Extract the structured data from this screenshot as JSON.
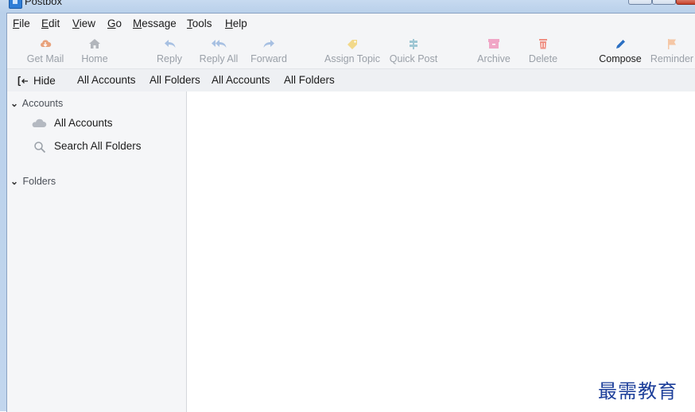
{
  "window": {
    "title": "Postbox"
  },
  "menubar": {
    "items": [
      {
        "key": "F",
        "rest": "ile"
      },
      {
        "key": "E",
        "rest": "dit"
      },
      {
        "key": "V",
        "rest": "iew"
      },
      {
        "key": "G",
        "rest": "o"
      },
      {
        "key": "M",
        "rest": "essage"
      },
      {
        "key": "T",
        "rest": "ools"
      },
      {
        "key": "H",
        "rest": "elp"
      }
    ]
  },
  "toolbar": {
    "get_mail": "Get Mail",
    "home": "Home",
    "reply": "Reply",
    "reply_all": "Reply All",
    "forward": "Forward",
    "assign_topic": "Assign Topic",
    "quick_post": "Quick Post",
    "archive": "Archive",
    "delete": "Delete",
    "compose": "Compose",
    "reminder": "Reminder"
  },
  "icons": {
    "get_mail": "cloud-download-icon",
    "home": "home-icon",
    "reply": "reply-icon",
    "reply_all": "reply-all-icon",
    "forward": "forward-icon",
    "assign_topic": "tag-icon",
    "quick_post": "signpost-icon",
    "archive": "archive-box-icon",
    "delete": "trash-icon",
    "compose": "pen-icon",
    "reminder": "flag-icon"
  },
  "colors": {
    "get_mail": "#e8a27c",
    "home": "#b2b6bc",
    "reply": "#a7c0e2",
    "reply_all": "#a7c0e2",
    "forward": "#a7c0e2",
    "assign_topic": "#f2d98a",
    "quick_post": "#9fc7d4",
    "archive": "#f0a6c6",
    "delete": "#ef8f83",
    "compose": "#2b6fc2",
    "reminder": "#f5c7a6"
  },
  "folderbar": {
    "hide": "Hide",
    "items": [
      "All Accounts",
      "All Folders",
      "All Accounts",
      "All Folders"
    ]
  },
  "sidebar": {
    "accounts_header": "Accounts",
    "all_accounts": "All Accounts",
    "search_all_folders": "Search All Folders",
    "folders_header": "Folders"
  },
  "watermark": "最需教育"
}
